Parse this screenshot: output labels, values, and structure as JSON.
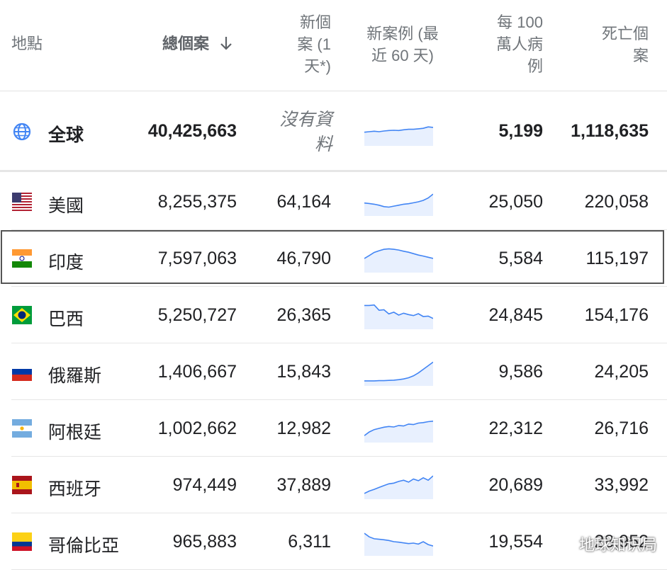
{
  "header": {
    "location": "地點",
    "total_cases": "總個案",
    "sort_icon": "arrow-down-icon",
    "new_cases_line1": "新個",
    "new_cases_line2": "案 (1",
    "new_cases_line3": "天*)",
    "trend_line1": "新案例 (最",
    "trend_line2": "近 60 天)",
    "per_million_line1": "每 100",
    "per_million_line2": "萬人病",
    "per_million_line3": "例",
    "deaths_line1": "死亡個",
    "deaths_line2": "案"
  },
  "global_row": {
    "icon": "globe-icon",
    "name": "全球",
    "total": "40,425,663",
    "new_line1": "沒有資",
    "new_line2": "料",
    "per_million": "5,199",
    "deaths": "1,118,635"
  },
  "rows": [
    {
      "name": "美國",
      "flag": "us-flag-icon",
      "total": "8,255,375",
      "new": "64,164",
      "per_million": "25,050",
      "deaths": "220,058"
    },
    {
      "name": "印度",
      "flag": "india-flag-icon",
      "total": "7,597,063",
      "new": "46,790",
      "per_million": "5,584",
      "deaths": "115,197",
      "selected": true
    },
    {
      "name": "巴西",
      "flag": "brazil-flag-icon",
      "total": "5,250,727",
      "new": "26,365",
      "per_million": "24,845",
      "deaths": "154,176"
    },
    {
      "name": "俄羅斯",
      "flag": "russia-flag-icon",
      "total": "1,406,667",
      "new": "15,843",
      "per_million": "9,586",
      "deaths": "24,205"
    },
    {
      "name": "阿根廷",
      "flag": "argentina-flag-icon",
      "total": "1,002,662",
      "new": "12,982",
      "per_million": "22,312",
      "deaths": "26,716"
    },
    {
      "name": "西班牙",
      "flag": "spain-flag-icon",
      "total": "974,449",
      "new": "37,889",
      "per_million": "20,689",
      "deaths": "33,992"
    },
    {
      "name": "哥倫比亞",
      "flag": "colombia-flag-icon",
      "total": "965,883",
      "new": "6,311",
      "per_million": "19,554",
      "deaths": "28,952"
    }
  ],
  "sparklines": {
    "global": [
      0.48,
      0.5,
      0.52,
      0.5,
      0.53,
      0.55,
      0.56,
      0.55,
      0.58,
      0.6,
      0.6,
      0.62,
      0.64,
      0.7,
      0.68
    ],
    "us": [
      0.45,
      0.43,
      0.4,
      0.36,
      0.3,
      0.28,
      0.32,
      0.36,
      0.4,
      0.42,
      0.46,
      0.5,
      0.56,
      0.66,
      0.82
    ],
    "india": [
      0.5,
      0.62,
      0.75,
      0.82,
      0.88,
      0.9,
      0.88,
      0.85,
      0.8,
      0.76,
      0.7,
      0.64,
      0.6,
      0.55,
      0.5
    ],
    "brazil": [
      0.9,
      0.9,
      0.92,
      0.7,
      0.72,
      0.55,
      0.62,
      0.5,
      0.58,
      0.52,
      0.48,
      0.56,
      0.44,
      0.46,
      0.36
    ],
    "russia": [
      0.12,
      0.12,
      0.12,
      0.13,
      0.13,
      0.14,
      0.15,
      0.17,
      0.2,
      0.25,
      0.33,
      0.45,
      0.6,
      0.75,
      0.9
    ],
    "argentina": [
      0.2,
      0.35,
      0.45,
      0.5,
      0.55,
      0.58,
      0.56,
      0.62,
      0.6,
      0.68,
      0.66,
      0.72,
      0.74,
      0.78,
      0.8
    ],
    "spain": [
      0.15,
      0.25,
      0.32,
      0.4,
      0.48,
      0.55,
      0.58,
      0.65,
      0.7,
      0.62,
      0.75,
      0.68,
      0.8,
      0.7,
      0.88
    ],
    "colombia": [
      0.85,
      0.7,
      0.62,
      0.6,
      0.58,
      0.55,
      0.5,
      0.48,
      0.45,
      0.42,
      0.44,
      0.4,
      0.5,
      0.38,
      0.32
    ]
  },
  "colors": {
    "spark_line": "#4285f4",
    "spark_fill": "#e8f0fe",
    "globe": "#4285f4",
    "selected_border": "#555555"
  },
  "watermark": "地球知识局"
}
